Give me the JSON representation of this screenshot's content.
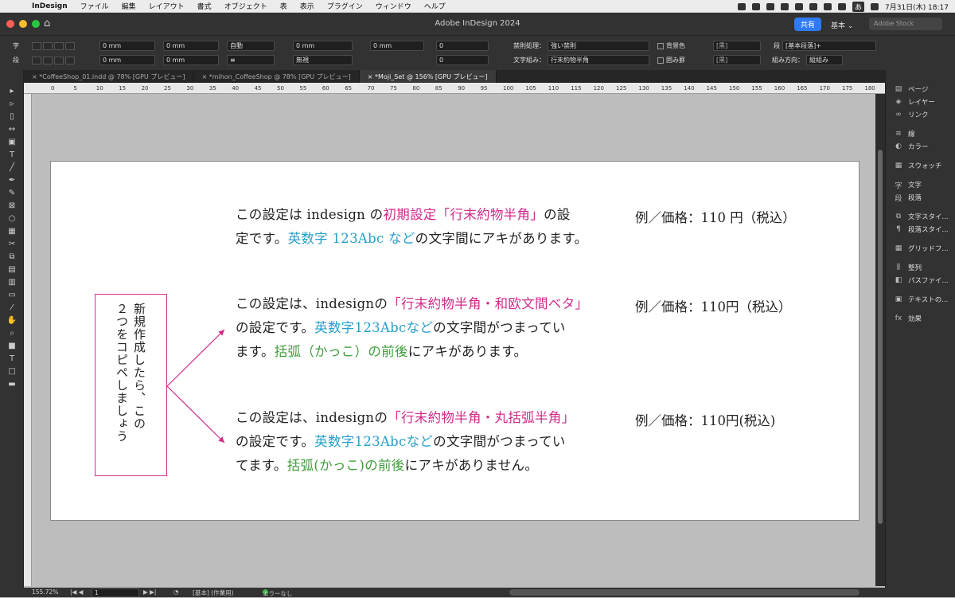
{
  "menubar": {
    "app": "InDesign",
    "items": [
      "ファイル",
      "編集",
      "レイアウト",
      "書式",
      "オブジェクト",
      "表",
      "表示",
      "プラグイン",
      "ウィンドウ",
      "ヘルプ"
    ],
    "clock": "7月31日(木)  18:17",
    "input_mode": "あ"
  },
  "titlebar": {
    "title": "Adobe InDesign 2024",
    "share": "共有",
    "workspace": "基本 ⌄",
    "stock_placeholder": "Adobe Stock"
  },
  "control": {
    "fields": {
      "left_indent": "0 mm",
      "right_indent": "0 mm",
      "first_line": "0 mm",
      "last_line": "0 mm",
      "space_before": "0 mm",
      "space_after": "0 mm",
      "drop_cap": "0",
      "drop_cap_lines": "0",
      "auto": "自動",
      "none": "無視"
    },
    "kinsoku_label": "禁則処理：",
    "kinsoku_value": "強い禁則",
    "mojikumi_label": "文字組み：",
    "mojikumi_value": "行末約物半角",
    "shading": "背景色",
    "border": "囲み罫",
    "black1": "[黒]",
    "black2": "[黒]",
    "para_style": "[基本段落]+",
    "composition_label": "組み方向：",
    "composition_value": "縦組み"
  },
  "tabs": [
    "*CoffeeShop_01.indd @ 78% [GPU プレビュー]",
    "*mihon_CoffeeShop @ 78% [GPU プレビュー]",
    "*Moji_Set @ 156% [GPU プレビュー]"
  ],
  "ruler": [
    "0",
    "5",
    "10",
    "15",
    "20",
    "25",
    "30",
    "35",
    "40",
    "45",
    "50",
    "55",
    "60",
    "65",
    "70",
    "75",
    "80",
    "85",
    "90",
    "95",
    "100",
    "105",
    "110",
    "115",
    "120",
    "125",
    "130",
    "135",
    "140",
    "145",
    "150",
    "155",
    "160",
    "165",
    "170",
    "175",
    "180"
  ],
  "text": {
    "b1_a": "この設定は indesign の",
    "b1_b": "初期設定「行末約物半角」",
    "b1_c": "の設",
    "b1_d": "定です。",
    "b1_e": "英数字 123Abc など",
    "b1_f": "の文字間にアキがあります。",
    "ex1": "例／価格：110 円（税込）",
    "b2_a": "この設定は、indesignの",
    "b2_b": "「行末約物半角・和欧文間ベタ」",
    "b2_c": "の設定です。",
    "b2_d": "英数字123Abcなど",
    "b2_e": "の文字間がつまってい",
    "b2_f": "ます。",
    "b2_g": "括弧（かっこ）の前後",
    "b2_h": "にアキがあります。",
    "ex2": "例／価格：110円（税込）",
    "b3_a": "この設定は、indesignの",
    "b3_b": "「行末約物半角・丸括弧半角」",
    "b3_c": "の設定です。",
    "b3_d": "英数字123Abcなど",
    "b3_e": "の文字間がつまってい",
    "b3_f": "てます。",
    "b3_g": "括弧(かっこ)の前後",
    "b3_h": "にアキがありません。",
    "ex3": "例／価格：110円(税込)",
    "note1": "新規作成したら、この",
    "note2": "２つをコピペしましょう"
  },
  "panel": [
    "ページ",
    "レイヤー",
    "リンク",
    "線",
    "カラー",
    "スウォッチ",
    "文字",
    "段落",
    "文字スタイ...",
    "段落スタイ...",
    "グリッドフ...",
    "整列",
    "パスファイ...",
    "テキストの...",
    "効果"
  ],
  "status": {
    "zoom": "155.72%",
    "page": "1",
    "style": "[基本] (作業用)",
    "errors": "エラーなし"
  },
  "colors": {
    "magenta": "#d12b8a",
    "cyan": "#26a0c9",
    "green": "#3e9e3a"
  }
}
